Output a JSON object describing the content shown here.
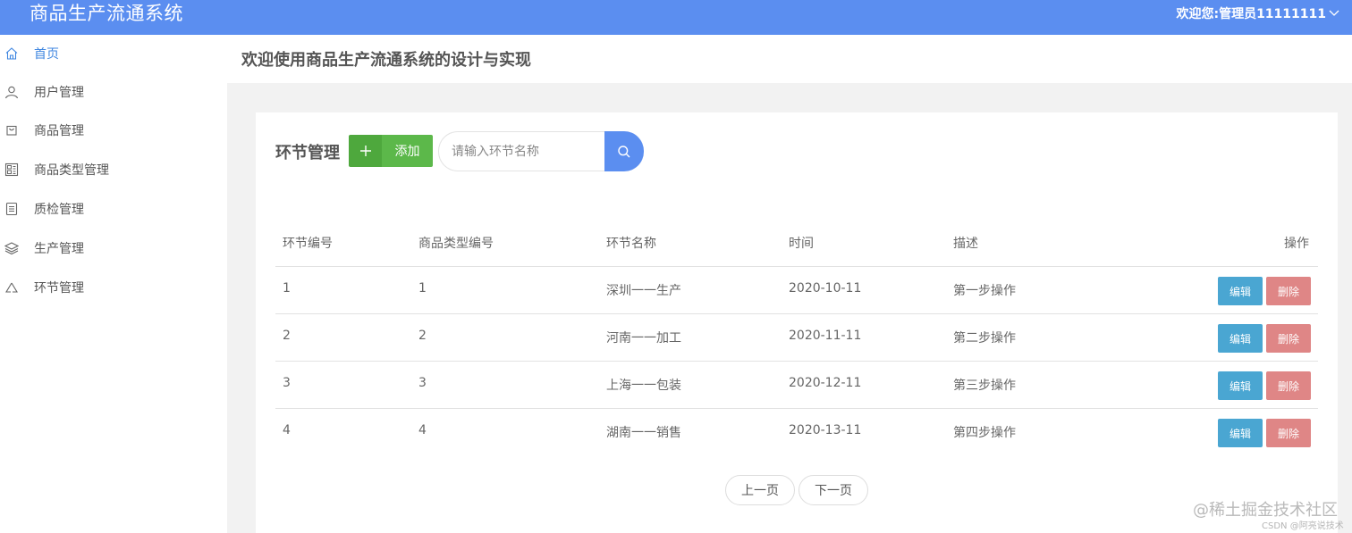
{
  "header": {
    "app_title": "商品生产流通系统",
    "user_menu": "欢迎您:管理员11111111"
  },
  "sidebar": {
    "items": [
      {
        "label": "首页",
        "icon": "home-icon",
        "active": true
      },
      {
        "label": "用户管理",
        "icon": "user-icon"
      },
      {
        "label": "商品管理",
        "icon": "bag-icon"
      },
      {
        "label": "商品类型管理",
        "icon": "grid-icon"
      },
      {
        "label": "质检管理",
        "icon": "document-icon"
      },
      {
        "label": "生产管理",
        "icon": "layers-icon"
      },
      {
        "label": "环节管理",
        "icon": "recycle-icon"
      }
    ]
  },
  "page": {
    "welcome": "欢迎使用商品生产流通系统的设计与实现"
  },
  "section": {
    "title": "环节管理",
    "add_label": "添加",
    "search_placeholder": "请输入环节名称"
  },
  "table": {
    "columns": [
      "环节编号",
      "商品类型编号",
      "环节名称",
      "时间",
      "描述",
      "操作"
    ],
    "rows": [
      [
        "1",
        "1",
        "深圳一一生产",
        "2020-10-11",
        "第一步操作"
      ],
      [
        "2",
        "2",
        "河南一一加工",
        "2020-11-11",
        "第二步操作"
      ],
      [
        "3",
        "3",
        "上海一一包装",
        "2020-12-11",
        "第三步操作"
      ],
      [
        "4",
        "4",
        "湖南一一销售",
        "2020-13-11",
        "第四步操作"
      ]
    ],
    "edit_label": "编辑",
    "delete_label": "删除"
  },
  "pagination": {
    "prev_label": "上一页",
    "next_label": "下一页"
  },
  "watermark": {
    "main": "@稀土掘金技术社区",
    "sub": "CSDN @阿亮说技术"
  },
  "colors": {
    "topbar": "#5b8ef0",
    "active_nav": "#3f86e0",
    "add_button": "#5cb84a",
    "edit_button": "#4aa6d2",
    "delete_button": "#df8686"
  }
}
